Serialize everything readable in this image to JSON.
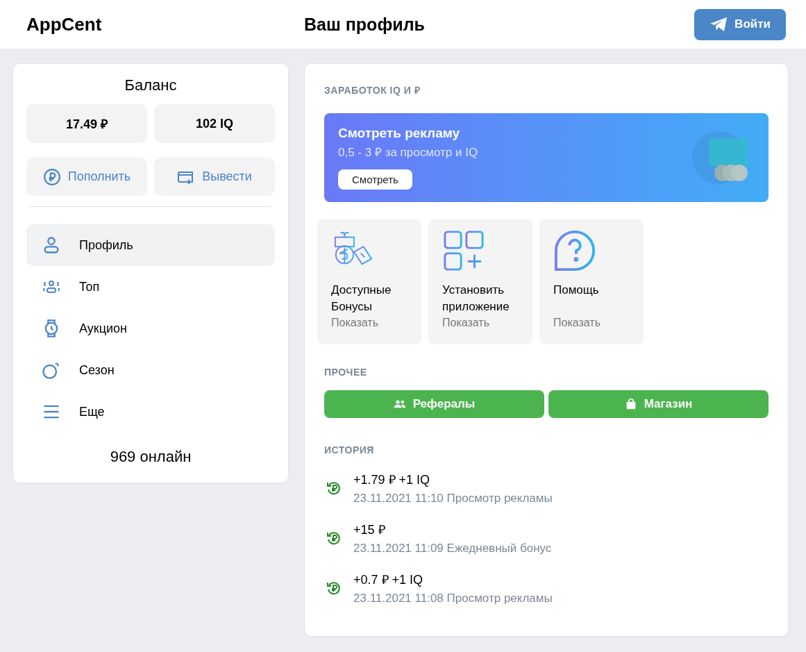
{
  "header": {
    "logo": "AppCent",
    "title": "Ваш профиль",
    "login_button": "Войти"
  },
  "balance": {
    "title": "Баланс",
    "amounts": [
      "17.49 ₽",
      "102 IQ"
    ],
    "actions": [
      "Пополнить",
      "Вывести"
    ]
  },
  "nav": [
    {
      "label": "Профиль",
      "selected": true
    },
    {
      "label": "Топ",
      "selected": false
    },
    {
      "label": "Аукцион",
      "selected": false
    },
    {
      "label": "Сезон",
      "selected": false
    },
    {
      "label": "Еще",
      "selected": false
    }
  ],
  "online": "969 онлайн",
  "earn": {
    "heading": "ЗАРАБОТОК IQ И ₽",
    "banner": {
      "title": "Смотреть рекламу",
      "subtitle": "0,5 - 3 ₽ за просмотр и IQ",
      "button": "Смотреть"
    },
    "tiles": [
      {
        "title": "Доступные Бонусы",
        "action": "Показать"
      },
      {
        "title": "Установить приложение",
        "action": "Показать"
      },
      {
        "title": "Помощь",
        "action": "Показать"
      }
    ]
  },
  "other": {
    "heading": "ПРОЧЕЕ",
    "buttons": [
      "Рефералы",
      "Магазин"
    ]
  },
  "history": {
    "heading": "ИСТОРИЯ",
    "items": [
      {
        "amount": "+1.79 ₽ +1 IQ",
        "details": "23.11.2021 11:10 Просмотр рекламы"
      },
      {
        "amount": "+15 ₽",
        "details": "23.11.2021 11:09 Ежедневный бонус"
      },
      {
        "amount": "+0.7 ₽ +1 IQ",
        "details": "23.11.2021 11:08 Просмотр рекламы"
      }
    ]
  }
}
